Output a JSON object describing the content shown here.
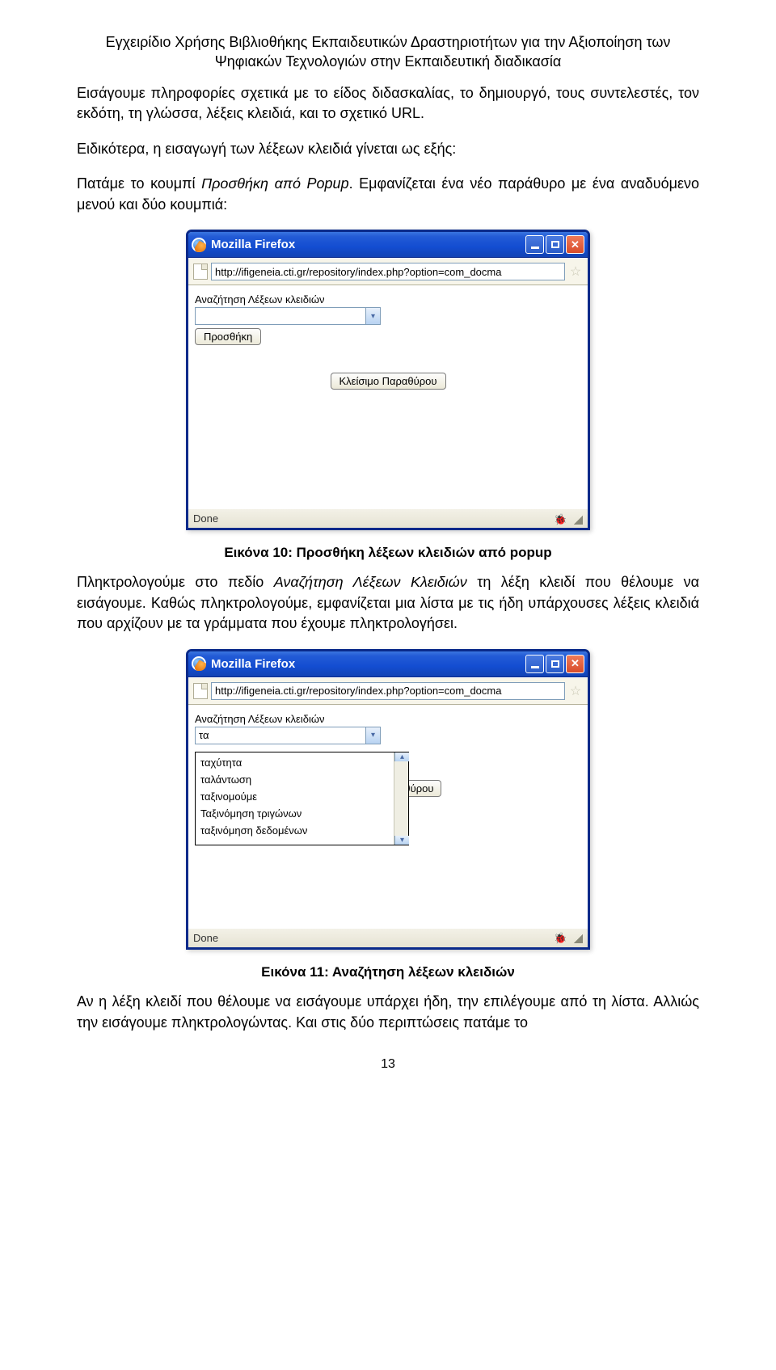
{
  "header": {
    "line1": "Εγχειρίδιο Χρήσης Βιβλιοθήκης Εκπαιδευτικών Δραστηριοτήτων για την Αξιοποίηση των",
    "line2": "Ψηφιακών Τεχνολογιών στην Εκπαιδευτική διαδικασία"
  },
  "paragraphs": {
    "p1": "Εισάγουμε πληροφορίες σχετικά με το είδος διδασκαλίας, το δημιουργό, τους συντελεστές, τον εκδότη, τη γλώσσα, λέξεις κλειδιά, και το σχετικό URL.",
    "p2": "Ειδικότερα, η εισαγωγή των λέξεων κλειδιά γίνεται ως εξής:",
    "p3a": "Πατάμε το κουμπί ",
    "p3b": "Προσθήκη από Popup",
    "p3c": ". Εμφανίζεται ένα νέο παράθυρο με ένα αναδυόμενο μενού και δύο κουμπιά:",
    "p4a": "Πληκτρολογούμε στο πεδίο ",
    "p4b": "Αναζήτηση Λέξεων Κλειδιών",
    "p4c": " τη λέξη κλειδί που θέλουμε να εισάγουμε. Καθώς πληκτρολογούμε, εμφανίζεται μια λίστα με τις ήδη υπάρχουσες λέξεις κλειδιά που αρχίζουν με τα γράμματα που έχουμε πληκτρολογήσει.",
    "p5": "Αν η λέξη κλειδί που θέλουμε να εισάγουμε υπάρχει ήδη, την επιλέγουμε από τη λίστα. Αλλιώς την εισάγουμε πληκτρολογώντας. Και στις δύο περιπτώσεις πατάμε το"
  },
  "captions": {
    "fig10": "Εικόνα 10: Προσθήκη λέξεων κλειδιών από popup",
    "fig11": "Εικόνα 11: Αναζήτηση λέξεων κλειδιών"
  },
  "popup1": {
    "title": "Mozilla Firefox",
    "url": "http://ifigeneia.cti.gr/repository/index.php?option=com_docma",
    "searchLabel": "Αναζήτηση Λέξεων κλειδιών",
    "comboValue": "",
    "addBtn": "Προσθήκη",
    "closeBtn": "Κλείσιμο Παραθύρου",
    "status": "Done"
  },
  "popup2": {
    "title": "Mozilla Firefox",
    "url": "http://ifigeneia.cti.gr/repository/index.php?option=com_docma",
    "searchLabel": "Αναζήτηση Λέξεων κλειδιών",
    "comboValue": "τα",
    "partialBtn": "αραθύρου",
    "options": [
      "ταχύτητα",
      "ταλάντωση",
      "ταξινομούμε",
      "Ταξινόμηση τριγώνων",
      "ταξινόμηση δεδομένων"
    ],
    "status": "Done"
  },
  "pageNumber": "13"
}
